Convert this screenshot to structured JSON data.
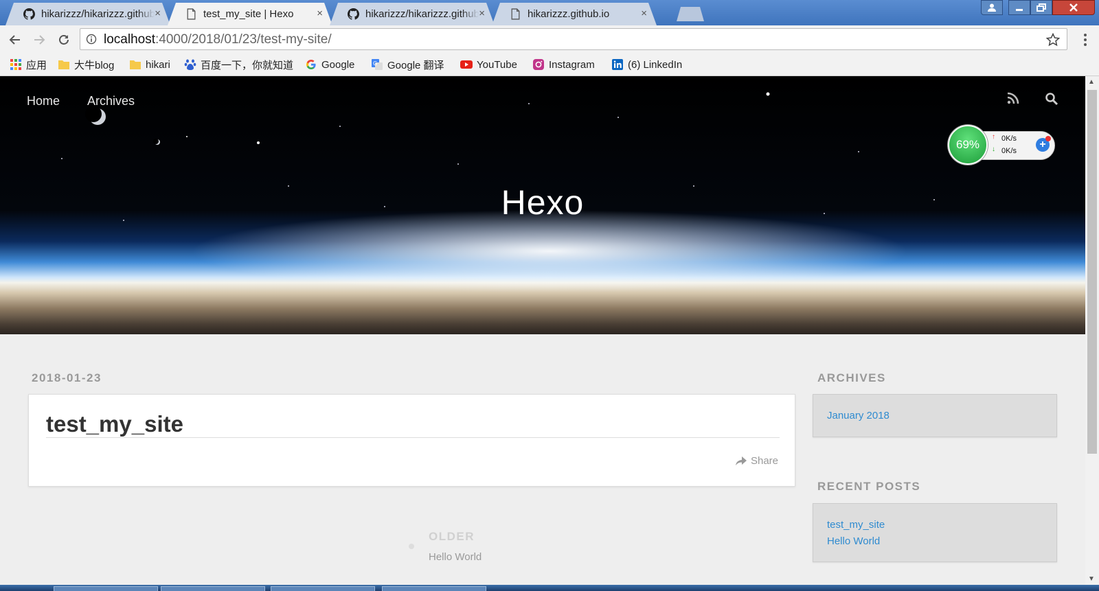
{
  "browser": {
    "tabs": [
      {
        "title": "hikarizzz/hikarizzz.github.io",
        "icon": "github-icon",
        "close": "×",
        "active": false
      },
      {
        "title": "test_my_site | Hexo",
        "icon": "page-icon",
        "close": "×",
        "active": true
      },
      {
        "title": "hikarizzz/hikarizzz.github.io",
        "icon": "github-icon",
        "close": "×",
        "active": false
      },
      {
        "title": "hikarizzz.github.io",
        "icon": "page-icon",
        "close": "×",
        "active": false
      }
    ],
    "url_host": "localhost",
    "url_path": ":4000/2018/01/23/test-my-site/",
    "bookmarks": [
      {
        "label": "应用",
        "icon": "apps-grid-icon"
      },
      {
        "label": "大牛blog",
        "icon": "folder-icon"
      },
      {
        "label": "hikari",
        "icon": "folder-icon"
      },
      {
        "label": "百度一下，你就知道",
        "icon": "baidu-icon"
      },
      {
        "label": "Google",
        "icon": "google-icon"
      },
      {
        "label": "Google 翻译",
        "icon": "google-translate-icon"
      },
      {
        "label": "YouTube",
        "icon": "youtube-icon"
      },
      {
        "label": "Instagram",
        "icon": "instagram-icon"
      },
      {
        "label": "(6) LinkedIn",
        "icon": "linkedin-icon"
      }
    ]
  },
  "site": {
    "nav": {
      "home": "Home",
      "archives": "Archives"
    },
    "title": "Hexo"
  },
  "net_widget": {
    "percent": "69%",
    "upload": "0K/s",
    "download": "0K/s"
  },
  "post": {
    "date": "2018-01-23",
    "title": "test_my_site",
    "share_label": "Share"
  },
  "pager": {
    "older_label": "OLDER",
    "older_title": "Hello World"
  },
  "sidebar": {
    "archives_heading": "ARCHIVES",
    "archives": [
      "January 2018"
    ],
    "recent_heading": "RECENT POSTS",
    "recent": [
      "test_my_site",
      "Hello World"
    ]
  },
  "colors": {
    "link": "#2f8bd0",
    "active_tab": "#f2f2f2",
    "titlebar": "#3f74bd"
  }
}
